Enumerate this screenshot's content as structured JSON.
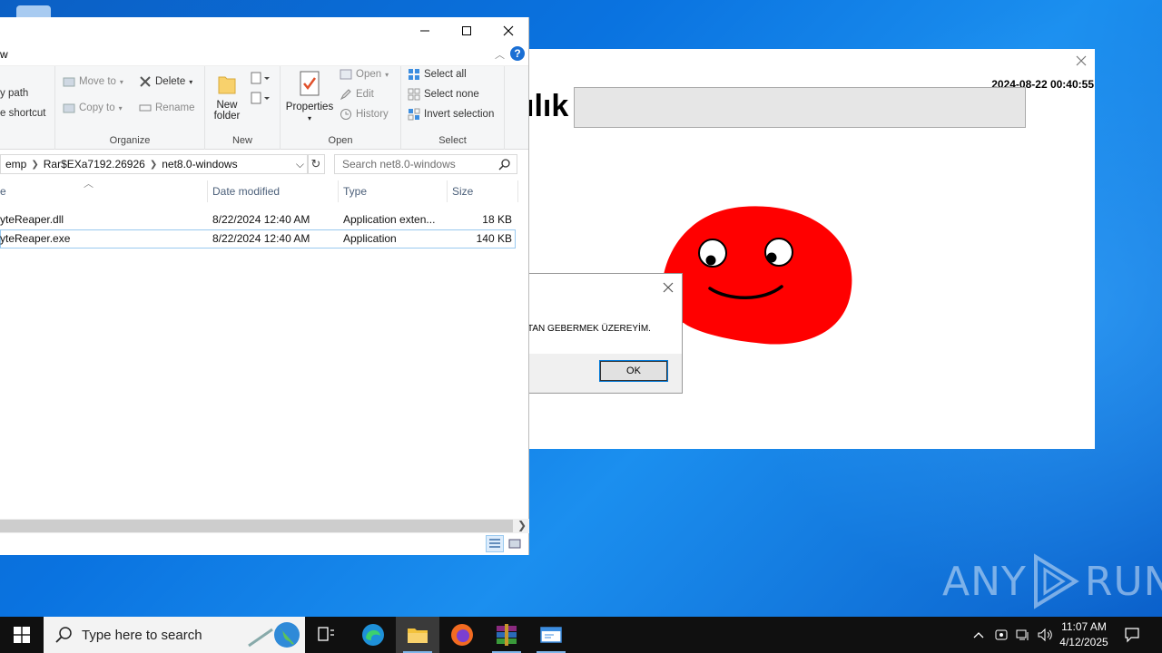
{
  "explorer": {
    "menu_fragment": "w",
    "ribbon": {
      "clipboard_partial": [
        "y path",
        "e shortcut"
      ],
      "organize": {
        "move_to": "Move to",
        "copy_to": "Copy to",
        "delete": "Delete",
        "rename": "Rename",
        "label": "Organize"
      },
      "new": {
        "new_folder_line1": "New",
        "new_folder_line2": "folder",
        "label": "New"
      },
      "open": {
        "properties": "Properties",
        "open": "Open",
        "edit": "Edit",
        "history": "History",
        "label": "Open"
      },
      "select": {
        "select_all": "Select all",
        "select_none": "Select none",
        "invert": "Invert selection",
        "label": "Select"
      }
    },
    "address": {
      "crumbs": [
        "emp",
        "Rar$EXa7192.26926",
        "net8.0-windows"
      ]
    },
    "search": {
      "placeholder": "Search net8.0-windows"
    },
    "columns": {
      "name": "e",
      "date": "Date modified",
      "type": "Type",
      "size": "Size"
    },
    "files": [
      {
        "name": "yteReaper.dll",
        "date": "8/22/2024 12:40 AM",
        "type": "Application exten...",
        "size": "18 KB"
      },
      {
        "name": "yteReaper.exe",
        "date": "8/22/2024 12:40 AM",
        "type": "Application",
        "size": "140 KB"
      }
    ]
  },
  "prank_window": {
    "timestamp": "2024-08-22 00:40:55",
    "title_fragment": "ılık",
    "face_color": "#ff0000"
  },
  "message_box": {
    "text": "TAN GEBERMEK ÜZEREYİM.",
    "ok": "OK"
  },
  "taskbar": {
    "search_placeholder": "Type here to search",
    "time": "11:07 AM",
    "date": "4/12/2025"
  },
  "watermark": {
    "text": "ANY RUN"
  },
  "colors": {
    "desktop": "#0a73e0",
    "accent": "#0078d7",
    "taskbar": "#101010"
  }
}
